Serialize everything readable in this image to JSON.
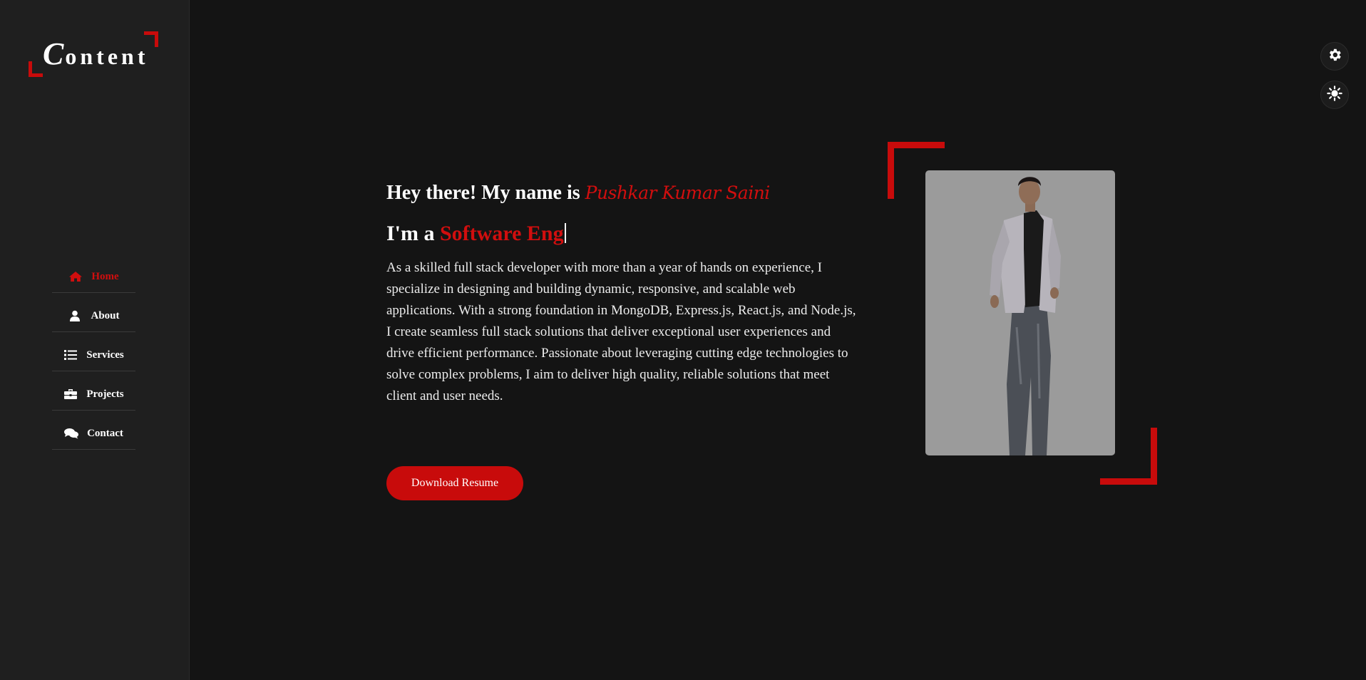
{
  "logo": {
    "first_letter": "C",
    "rest": "ontent"
  },
  "nav": [
    {
      "label": "Home",
      "icon": "home-icon",
      "active": true
    },
    {
      "label": "About",
      "icon": "user-icon",
      "active": false
    },
    {
      "label": "Services",
      "icon": "list-icon",
      "active": false
    },
    {
      "label": "Projects",
      "icon": "briefcase-icon",
      "active": false
    },
    {
      "label": "Contact",
      "icon": "comments-icon",
      "active": false
    }
  ],
  "hero": {
    "greeting_prefix": "Hey there! My name is",
    "name": "Pushkar Kumar Saini",
    "role_prefix": "I'm a",
    "role_typed": "Software Eng",
    "bio": "As a skilled full stack developer with more than a year of hands on experience, I specialize in designing and building dynamic, responsive, and scalable web applications. With a strong foundation in MongoDB, Express.js, React.js, and Node.js, I create seamless full stack solutions that deliver exceptional user experiences and drive efficient performance. Passionate about leveraging cutting edge technologies to solve complex problems, I aim to deliver high quality, reliable solutions that meet client and user needs.",
    "download_label": "Download Resume"
  },
  "top_buttons": {
    "settings_icon": "gear-icon",
    "theme_icon": "sun-icon"
  },
  "colors": {
    "accent": "#c80b0b",
    "background": "#141414",
    "sidebar": "#1f1f1f",
    "photo_bg": "#9b9b9b"
  }
}
